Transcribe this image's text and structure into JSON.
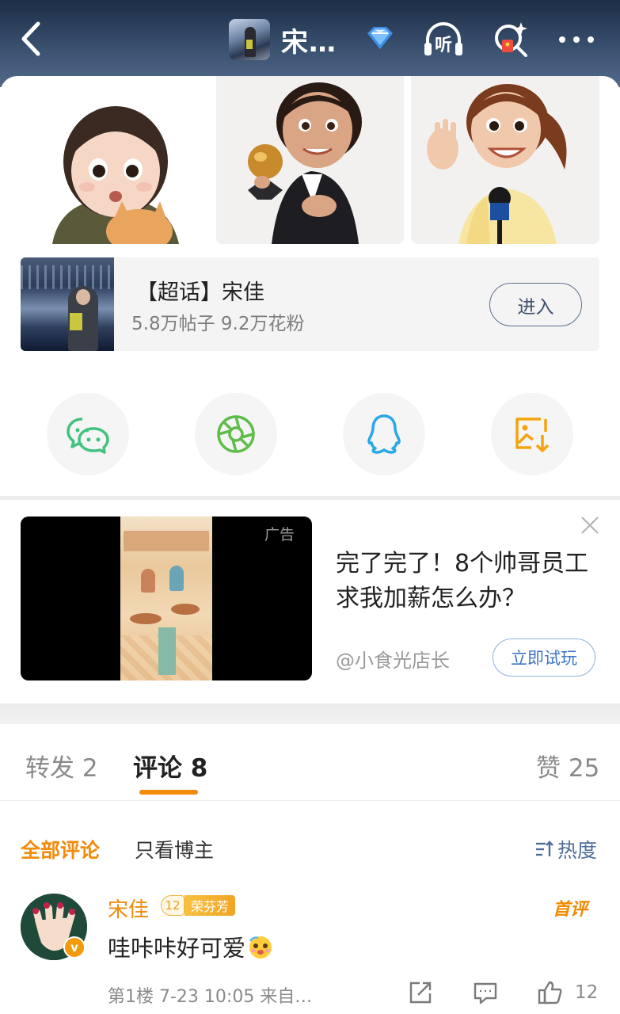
{
  "header": {
    "title": "宋…",
    "icons": [
      "back-icon",
      "diamond-icon",
      "listen-icon",
      "search-sparkle-icon",
      "more-icon"
    ],
    "listen_glyph": "听"
  },
  "stickers": [
    "sticker-girl-with-dog",
    "sticker-woman-with-trophy",
    "sticker-woman-with-microphone"
  ],
  "supertopic": {
    "title": "【超话】宋佳",
    "stats": "5.8万帖子 9.2万花粉",
    "enter_label": "进入"
  },
  "share": {
    "items": [
      "wechat-icon",
      "moments-icon",
      "qq-icon",
      "save-image-icon"
    ],
    "colors": {
      "wechat": "#43c17f",
      "moments": "#5fbd4a",
      "qq": "#29a7e8",
      "save": "#f5a30f"
    }
  },
  "ad": {
    "tag": "广告",
    "title": "完了完了！8个帅哥员工求我加薪怎么办？",
    "source": "@小食光店长",
    "cta": "立即试玩"
  },
  "tabs": {
    "repost": "转发 2",
    "comments": "评论 8",
    "likes": "赞 25",
    "active_color": "#f28a0a"
  },
  "filters": {
    "all": "全部评论",
    "host_only": "只看博主",
    "sort": "热度"
  },
  "comment": {
    "author": "宋佳",
    "level": "12",
    "badge": "荣芬芳",
    "first_tag": "首评",
    "text": "哇咔咔好可爱",
    "meta": "第1楼 7-23 10:05 来自…",
    "likes": "12",
    "verified": "v"
  }
}
